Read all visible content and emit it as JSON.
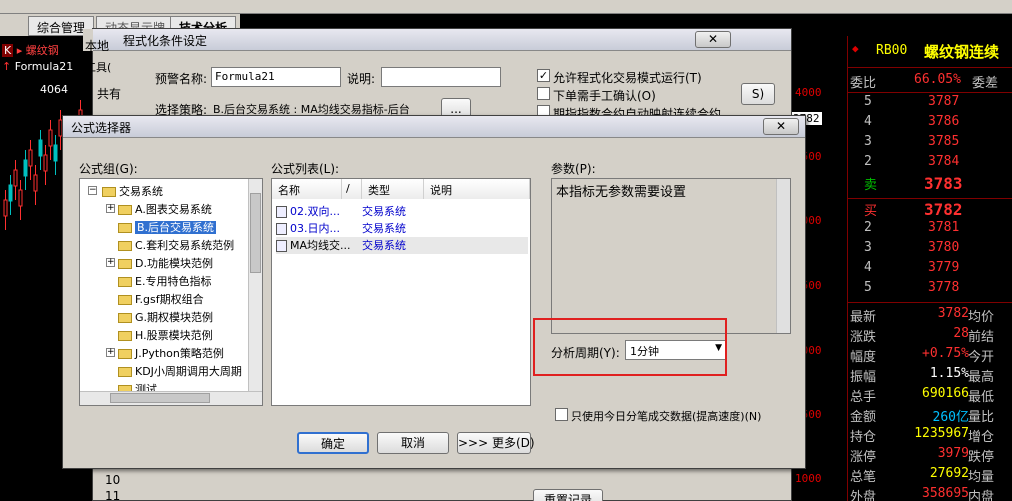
{
  "topbar": {
    "tabs": [
      "综合管理",
      "动态显示牌",
      "技术分析"
    ]
  },
  "chart": {
    "symbol": "螺纹钢",
    "formula": "Formula21",
    "price_label": "4064",
    "y_labels": [
      "4000",
      "3500",
      "3000",
      "2500",
      "2000",
      "1500",
      "1000"
    ],
    "current_price_tag": "3782"
  },
  "quote": {
    "code": "RB00",
    "name": "螺纹钢连续",
    "weibi_label": "委比",
    "weibi_value": "66.05%",
    "weicha_label": "委差",
    "asks": [
      {
        "level": "5",
        "price": "3787"
      },
      {
        "level": "4",
        "price": "3786"
      },
      {
        "level": "3",
        "price": "3785"
      },
      {
        "level": "2",
        "price": "3784"
      },
      {
        "level": "卖",
        "price": "3783"
      }
    ],
    "bids": [
      {
        "level": "买",
        "price": "3782"
      },
      {
        "level": "2",
        "price": "3781"
      },
      {
        "level": "3",
        "price": "3780"
      },
      {
        "level": "4",
        "price": "3779"
      },
      {
        "level": "5",
        "price": "3778"
      }
    ],
    "stats": [
      {
        "l": "最新",
        "v": "3782",
        "r": "均价"
      },
      {
        "l": "涨跌",
        "v": "28",
        "r": "前结"
      },
      {
        "l": "幅度",
        "v": "+0.75%",
        "r": "今开"
      },
      {
        "l": "振幅",
        "v": "1.15%",
        "r": "最高"
      },
      {
        "l": "总手",
        "v": "690166",
        "r": "最低"
      },
      {
        "l": "金额",
        "v": "260亿",
        "r": "量比"
      },
      {
        "l": "持仓",
        "v": "1235967",
        "r": "增仓"
      },
      {
        "l": "涨停",
        "v": "3979",
        "r": "跌停"
      },
      {
        "l": "总笔",
        "v": "27692",
        "r": "均量"
      },
      {
        "l": "外盘",
        "v": "358695",
        "r": "内盘"
      }
    ]
  },
  "back_dialog": {
    "title": "程式化条件设定",
    "underlying_title": "本地",
    "underlying_menu": "工具(",
    "underlying_label": "共有",
    "warn_name_label": "预警名称:",
    "warn_name_value": "Formula21",
    "desc_label": "说明:",
    "desc_value": "",
    "strategy_label": "选择策略:",
    "strategy_value": "B.后台交易系统 : MA均线交易指标-后台",
    "browse_label": "...",
    "allow_trade_label": "允许程式化交易模式运行(T)",
    "allow_trade_checked": true,
    "manual_confirm_label": "下单需手工确认(O)",
    "manual_confirm_checked": false,
    "index_switch_label": "期指指数合约自动映射连续合约",
    "index_switch_checked": false,
    "side_btn_label": "S)",
    "row_numbers": [
      "10",
      "11"
    ],
    "reset_btn_label": "重置记录"
  },
  "front_dialog": {
    "title": "公式选择器",
    "group_label": "公式组(G):",
    "list_label": "公式列表(L):",
    "params_label": "参数(P):",
    "params_text": "本指标无参数需要设置",
    "tree": [
      {
        "label": "交易系统",
        "level": 0,
        "expanded": true
      },
      {
        "label": "A.图表交易系统",
        "level": 1,
        "expanded": false
      },
      {
        "label": "B.后台交易系统",
        "level": 1,
        "selected": true
      },
      {
        "label": "C.套利交易系统范例",
        "level": 1
      },
      {
        "label": "D.功能模块范例",
        "level": 1,
        "expanded": false
      },
      {
        "label": "E.专用特色指标",
        "level": 1
      },
      {
        "label": "F.gsf期权组合",
        "level": 1
      },
      {
        "label": "G.期权模块范例",
        "level": 1
      },
      {
        "label": "H.股票模块范例",
        "level": 1
      },
      {
        "label": "J.Python策略范例",
        "level": 1,
        "expanded": false
      },
      {
        "label": "KDJ小周期调用大周期",
        "level": 1
      },
      {
        "label": "测试",
        "level": 1
      }
    ],
    "columns": [
      "名称",
      "/",
      "类型",
      "说明"
    ],
    "formulas": [
      {
        "name": "02.双向...",
        "type": "交易系统",
        "selected": false
      },
      {
        "name": "03.日内...",
        "type": "交易系统",
        "selected": false
      },
      {
        "name": "MA均线交...",
        "type": "交易系统",
        "selected": true
      }
    ],
    "period_label": "分析周期(Y):",
    "period_value": "1分钟",
    "only_today_label": "只使用今日分笔成交数据(提高速度)(N)",
    "only_today_checked": false,
    "ok_label": "确定",
    "cancel_label": "取消",
    "more_label": ">>> 更多(D)",
    "close_label": "✕"
  },
  "colors": {
    "up": "#ff3030",
    "down": "#00c000",
    "accent_blue": "#0000cc",
    "highlight": "#e02020"
  }
}
